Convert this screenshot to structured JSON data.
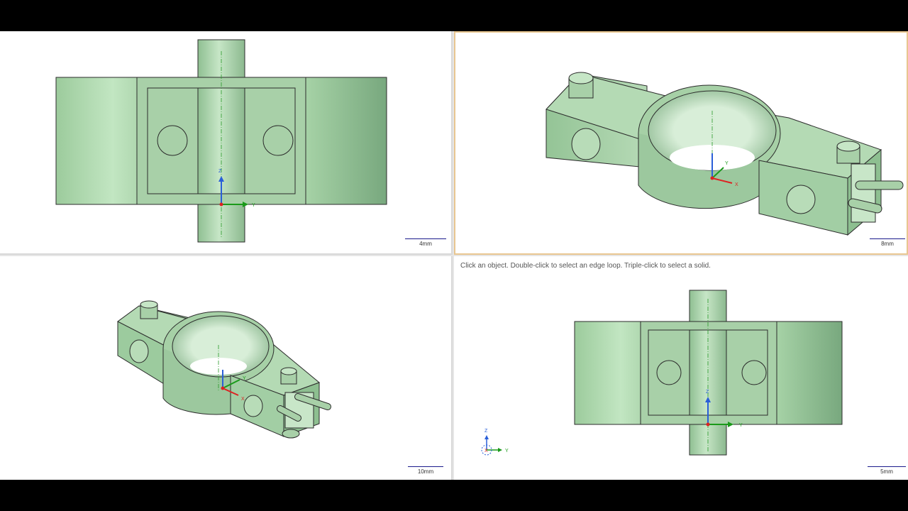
{
  "status": {
    "hint": "Click an object. Double-click to select an edge loop. Triple-click to select a solid."
  },
  "scales": {
    "top_left": "4mm",
    "top_right": "8mm",
    "bottom_left": "10mm",
    "bottom_right": "5mm"
  },
  "axes": {
    "x": "X",
    "y": "Y",
    "z": "Z"
  },
  "colors": {
    "part_fill": "#a8d0a8",
    "part_light": "#c2e2c2",
    "part_dark": "#7fae84",
    "edge": "#2b2b2b",
    "x_axis": "#d22",
    "y_axis": "#1a9a1a",
    "z_axis": "#2a5fd8",
    "active_border": "#e8c690"
  }
}
